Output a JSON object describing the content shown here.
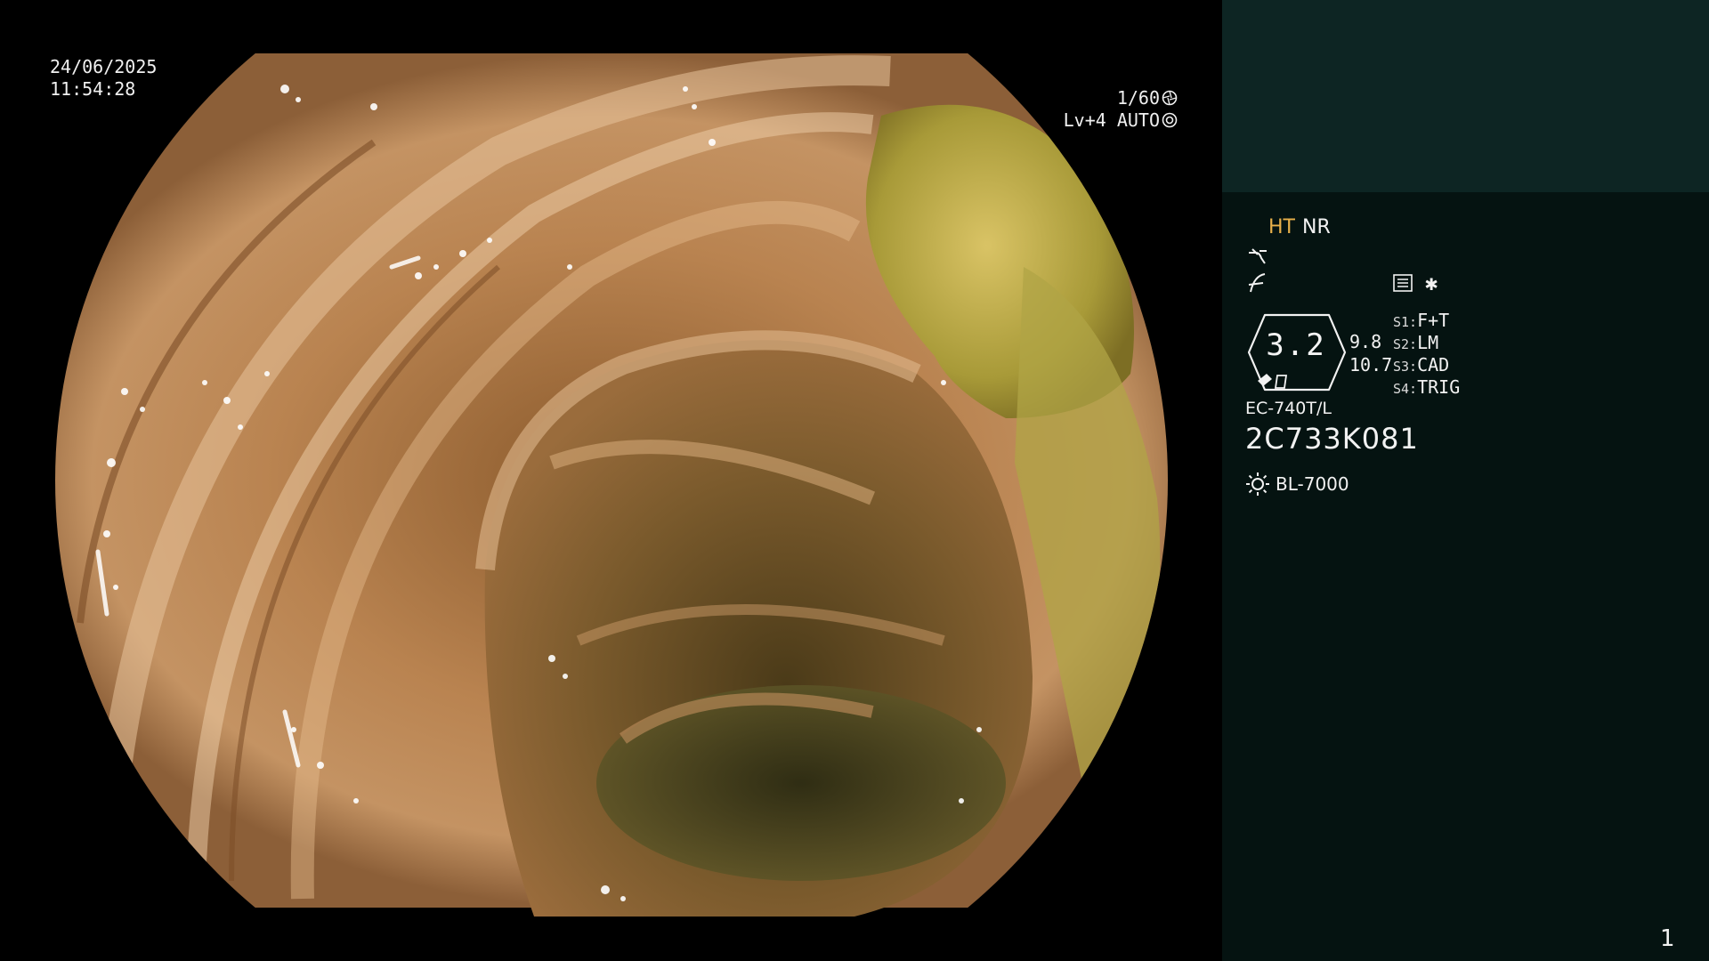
{
  "video": {
    "date": "24/06/2025",
    "time": "11:54:28",
    "shutter": "1/60",
    "level": "Lv+4 AUTO",
    "shutter_icon": "aperture-icon",
    "auto_icon": "auto-iris-icon"
  },
  "panel": {
    "ht_label": "HT",
    "nr_label": "NR",
    "ht_color": "#e8b04a",
    "icons": [
      "tone-curve-icon",
      "enhancement-icon",
      "menu-list-icon",
      "star-icon"
    ],
    "star_glyph": "✱",
    "gauge_value": "3.2",
    "gauge_sub1": "9.8",
    "gauge_sub2": "10.7",
    "switches": [
      {
        "key": "S1:",
        "value": "F+T"
      },
      {
        "key": "S2:",
        "value": "LM"
      },
      {
        "key": "S3:",
        "value": "CAD"
      },
      {
        "key": "S4:",
        "value": "TRIG"
      }
    ],
    "scope_model": "EC-740T/L",
    "scope_serial": "2C733K081",
    "light_source": "BL-7000",
    "page_number": "1"
  },
  "colors": {
    "panel_top": "#0d2523",
    "panel_bottom": "#051311",
    "mucosa": "#b9834f",
    "bile": "#a89a38"
  }
}
